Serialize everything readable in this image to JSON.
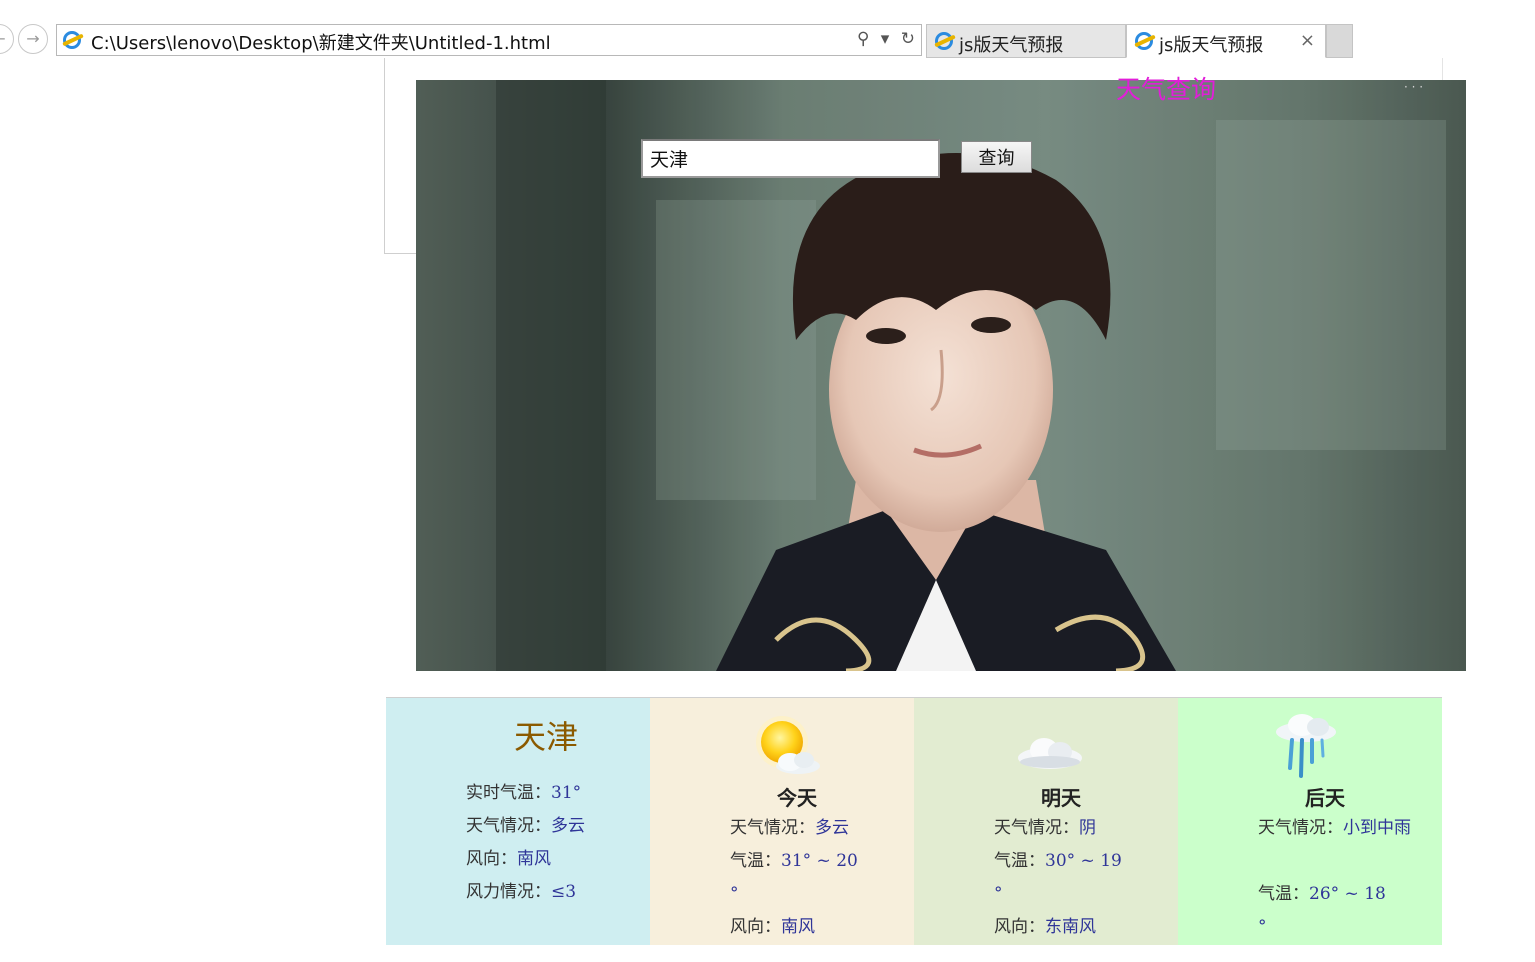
{
  "browser": {
    "address": "C:\\Users\\lenovo\\Desktop\\新建文件夹\\Untitled-1.html",
    "tabs": [
      {
        "label": "js版天气预报",
        "active": false
      },
      {
        "label": "js版天气预报",
        "active": true
      }
    ],
    "close_glyph": "×"
  },
  "page": {
    "title": "天气查询",
    "search_value": "天津",
    "search_button": "查询",
    "title_color": "#e21dd9"
  },
  "current": {
    "city": "天津",
    "temp_label": "实时气温：",
    "temp": "31°",
    "cond_label": "天气情况：",
    "cond": "多云",
    "wind_dir_label": "风向：",
    "wind_dir": "南风",
    "wind_force_label": "风力情况：",
    "wind_force": "≤3"
  },
  "forecast": [
    {
      "day": "今天",
      "icon": "sunny-cloud-icon",
      "cond_label": "天气情况：",
      "cond": "多云",
      "temp_label": "气温：",
      "temp_high": "31°",
      "tilde": "~",
      "temp_low": "20",
      "deg": "°",
      "wind_label": "风向：",
      "wind": "南风"
    },
    {
      "day": "明天",
      "icon": "cloud-icon",
      "cond_label": "天气情况：",
      "cond": "阴",
      "temp_label": "气温：",
      "temp_high": "30°",
      "tilde": "~",
      "temp_low": "19",
      "deg": "°",
      "wind_label": "风向：",
      "wind": "东南风"
    },
    {
      "day": "后天",
      "icon": "rain-cloud-icon",
      "cond_label": "天气情况：",
      "cond": "小到中雨",
      "temp_label": "气温：",
      "temp_high": "26°",
      "tilde": "~",
      "temp_low": "18",
      "deg": "°"
    }
  ],
  "card_colors": [
    "#cfeef1",
    "#f7efdc",
    "#e2ecd1",
    "#cbffcb"
  ]
}
